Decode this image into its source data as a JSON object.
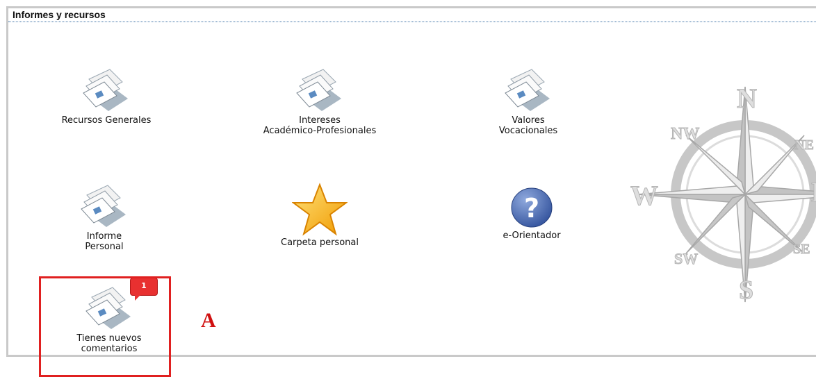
{
  "panel": {
    "title": "Informes y recursos"
  },
  "tiles": [
    {
      "label": "Recursos Generales"
    },
    {
      "label": "Intereses\nAcadémico-Profesionales"
    },
    {
      "label": "Valores\nVocacionales"
    },
    {
      "label": "Informe\nPersonal"
    },
    {
      "label": "Carpeta personal"
    },
    {
      "label": "e-Orientador"
    },
    {
      "label": "Tienes nuevos\ncomentarios"
    }
  ],
  "notification": {
    "count": "1"
  },
  "annotation": {
    "marker": "A"
  },
  "compass": {
    "labels": [
      "N",
      "NW",
      "NE",
      "W",
      "E",
      "SW",
      "SE",
      "S"
    ]
  },
  "colors": {
    "callout": "#e02020",
    "badge": "#e83030",
    "panel_border": "#c9c9c9"
  }
}
